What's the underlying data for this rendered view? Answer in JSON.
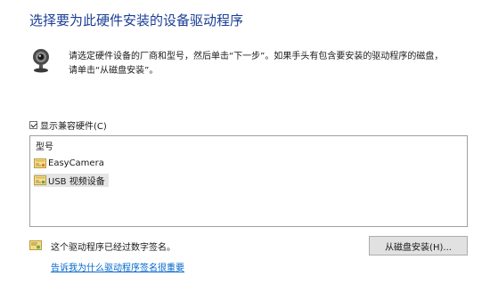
{
  "heading": "选择要为此硬件安装的设备驱动程序",
  "instructions": {
    "line1": "请选定硬件设备的厂商和型号，然后单击“下一步”。如果手头有包含要安装的驱动程序的磁盘，",
    "line2": "请单击“从磁盘安装”。"
  },
  "show_compatible": {
    "label": "显示兼容硬件(C)",
    "checked": true
  },
  "model_list": {
    "header": "型号",
    "items": [
      {
        "label": "EasyCamera",
        "selected": false
      },
      {
        "label": "USB 视频设备",
        "selected": true
      }
    ]
  },
  "signature_status": "这个驱动程序已经过数字签名。",
  "signature_link": "告诉我为什么驱动程序签名很重要",
  "have_disk_button": "从磁盘安装(H)...",
  "colors": {
    "heading": "#1a3e94",
    "link": "#0066cc",
    "selection": "#e5e5e5"
  },
  "icons": {
    "device": "webcam-icon",
    "list_item": "driver-icon",
    "signature": "certificate-icon"
  }
}
